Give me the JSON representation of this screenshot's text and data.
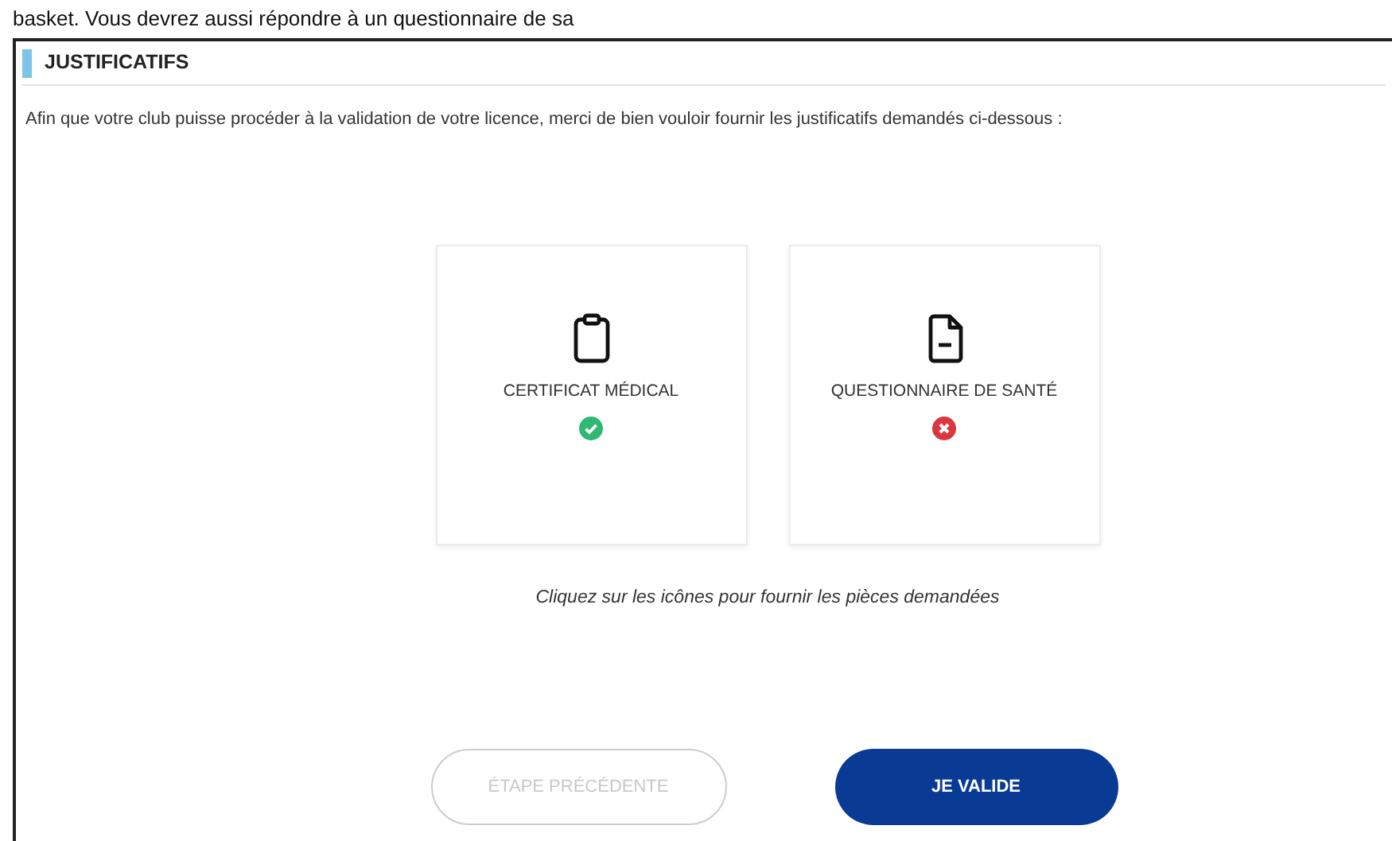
{
  "top_text": "basket. Vous devrez aussi répondre à un questionnaire de sa",
  "section": {
    "title": "JUSTIFICATIFS",
    "intro": "Afin que votre club puisse procéder à la validation de votre licence, merci de bien vouloir fournir les justificatifs demandés ci-dessous :"
  },
  "documents": [
    {
      "kind": "clipboard",
      "label": "CERTIFICAT MÉDICAL",
      "provided": true
    },
    {
      "kind": "file",
      "label": "QUESTIONNAIRE DE SANTÉ",
      "provided": false
    }
  ],
  "hint": "Cliquez sur les icônes pour fournir les pièces demandées",
  "buttons": [
    {
      "label": "ÉTAPE PRÉCÉDENTE",
      "disabled": true,
      "kind": "secondary"
    },
    {
      "label": "JE VALIDE",
      "disabled": false,
      "kind": "primary"
    }
  ]
}
